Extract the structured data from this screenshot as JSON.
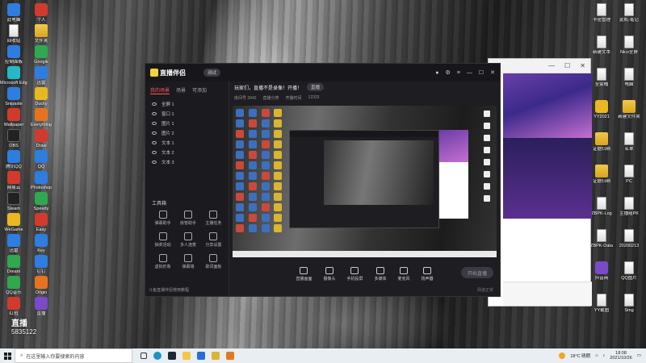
{
  "desktop_icons_left": [
    {
      "label": "此电脑",
      "color": "blue"
    },
    {
      "label": "回收站",
      "color": "doc"
    },
    {
      "label": "控制面板",
      "color": "blue"
    },
    {
      "label": "Microsoft Edge",
      "color": "cyan"
    },
    {
      "label": "Snipaste",
      "color": "blue"
    },
    {
      "label": "Wallpaper",
      "color": "red"
    },
    {
      "label": "OBS",
      "color": "dark"
    },
    {
      "label": "腾讯QQ",
      "color": "blue"
    },
    {
      "label": "网易云",
      "color": "red"
    },
    {
      "label": "Steam",
      "color": "dark"
    },
    {
      "label": "WeGame",
      "color": "yellow"
    },
    {
      "label": "迅雷",
      "color": "blue"
    },
    {
      "label": "Dream",
      "color": "green"
    },
    {
      "label": "QQ音乐",
      "color": "green"
    },
    {
      "label": "红包",
      "color": "red"
    }
  ],
  "desktop_icons_col2": [
    {
      "label": "个人",
      "color": "red"
    },
    {
      "label": "文件夹",
      "color": "folder"
    },
    {
      "label": "Google",
      "color": "green"
    },
    {
      "label": "迅雷",
      "color": "blue"
    },
    {
      "label": "Ducky",
      "color": "yellow"
    },
    {
      "label": "Everything",
      "color": "orange"
    },
    {
      "label": "Draw",
      "color": "red"
    },
    {
      "label": "QQ",
      "color": "blue"
    },
    {
      "label": "Photoshop",
      "color": "blue"
    },
    {
      "label": "Speedy",
      "color": "green"
    },
    {
      "label": "Easy",
      "color": "red"
    },
    {
      "label": "Key",
      "color": "blue"
    },
    {
      "label": "钉钉",
      "color": "blue"
    },
    {
      "label": "Origin",
      "color": "orange"
    },
    {
      "label": "直播",
      "color": "purple"
    }
  ],
  "desktop_icons_right": [
    {
      "label": "卡密管理",
      "color": "doc"
    },
    {
      "label": "此机-笔记",
      "color": "doc"
    },
    {
      "label": "新建文本",
      "color": "doc"
    },
    {
      "label": "Nico全屏",
      "color": "doc"
    },
    {
      "label": "全家桶",
      "color": "doc"
    },
    {
      "label": "电脑",
      "color": "doc"
    },
    {
      "label": "YY2021",
      "color": "yellow"
    },
    {
      "label": "新建文件夹",
      "color": "folder"
    },
    {
      "label": "证据归纳",
      "color": "folder"
    },
    {
      "label": "名单",
      "color": "doc"
    },
    {
      "label": "证据归纳",
      "color": "folder"
    },
    {
      "label": "PC",
      "color": "doc"
    },
    {
      "label": "ZBPK-Log",
      "color": "doc"
    },
    {
      "label": "主播组PK",
      "color": "doc"
    },
    {
      "label": "ZBPK-Data",
      "color": "doc"
    },
    {
      "label": "20200213",
      "color": "doc"
    },
    {
      "label": "抖音商",
      "color": "purple"
    },
    {
      "label": "QQ图片",
      "color": "doc"
    },
    {
      "label": "YY截图",
      "color": "doc"
    },
    {
      "label": "Smg",
      "color": "doc"
    }
  ],
  "app": {
    "logo_text": "直播伴侣",
    "version_pill": "测试",
    "sidebar_tabs": [
      "我的场景",
      "场景",
      "可添加"
    ],
    "scenes": [
      "全屏 1",
      "窗口 1",
      "图片 1",
      "图片 2",
      "文本 1",
      "文本 2",
      "文本 3"
    ],
    "tools_title": "工具箱",
    "tools": [
      "弹幕助手",
      "房管助手",
      "主播任务",
      "抽奖活动",
      "多人连麦",
      "分享设置",
      "虚拟形象",
      "弹幕墙",
      "歌词面板"
    ],
    "bottom_note": "斗鱼直播伴侣使用教程",
    "room_title": "玩家们，直播不是录像！开播！",
    "room_badge": "直播",
    "room_meta": [
      "房间号 2042",
      "直播分类",
      "开播时间",
      "12333"
    ],
    "controls": [
      "直播画面",
      "摄像头",
      "手机投屏",
      "多媒体",
      "麦克风",
      "扬声器"
    ],
    "live_button": "开始直播",
    "hint": "网速正常"
  },
  "taskbar": {
    "search_placeholder": "在这里输入你要搜索的内容",
    "weather": "18°C 晴朗",
    "time": "18:08",
    "date": "2021/10/26"
  },
  "corner_text": {
    "overlay_label": "直播",
    "overlay_number": "5835122"
  }
}
